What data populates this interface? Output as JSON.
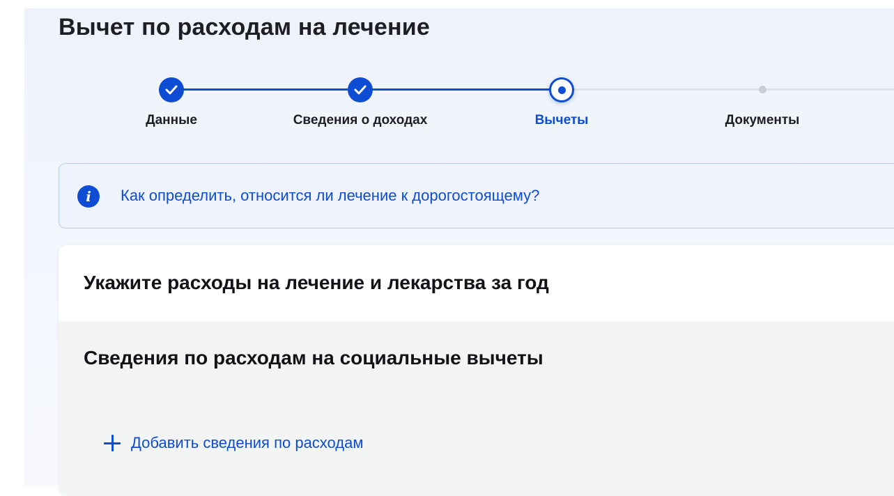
{
  "page": {
    "title": "Вычет по расходам на лечение"
  },
  "stepper": {
    "steps": [
      {
        "label": "Данные",
        "state": "done"
      },
      {
        "label": "Сведения о доходах",
        "state": "done"
      },
      {
        "label": "Вычеты",
        "state": "current"
      },
      {
        "label": "Документы",
        "state": "todo"
      }
    ]
  },
  "info": {
    "icon": "info-icon",
    "link_text": "Как определить, относится ли лечение к дорогостоящему?"
  },
  "card": {
    "title": "Укажите расходы на лечение и лекарства за год",
    "section_title": "Сведения по расходам на социальные вычеты",
    "add_button_label": "Добавить сведения по расходам"
  },
  "colors": {
    "accent": "#0d4cd3",
    "inactive": "#dfe2e8",
    "text": "#1d1f24"
  }
}
